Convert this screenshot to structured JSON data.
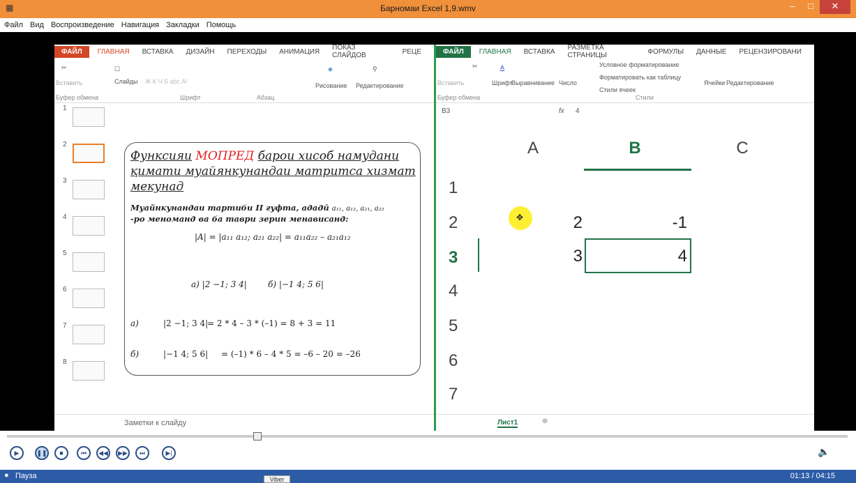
{
  "window": {
    "title": "Барномаи Excel 1,9.wmv"
  },
  "menu": [
    "Файл",
    "Вид",
    "Воспроизведение",
    "Навигация",
    "Закладки",
    "Помощь"
  ],
  "powerpoint": {
    "tabs": [
      "ФАЙЛ",
      "ГЛАВНАЯ",
      "ВСТАВКА",
      "ДИЗАЙН",
      "ПЕРЕХОДЫ",
      "АНИМАЦИЯ",
      "ПОКАЗ СЛАЙДОВ",
      "РЕЦЕ"
    ],
    "ribbon": {
      "paste": "Вставить",
      "slides": "Слайды",
      "drawing": "Рисование",
      "editing": "Редактирование"
    },
    "groups": {
      "clipboard": "Буфер обмена",
      "font": "Шрифт",
      "paragraph": "Абзац"
    },
    "slide_numbers": [
      "1",
      "2",
      "3",
      "4",
      "5",
      "6",
      "7",
      "8"
    ],
    "slide": {
      "title_1": "Функсияи",
      "title_red": "МОПРЕД",
      "title_2": "барои хисоб намудани қимати муайянкунандаи матритса хизмат мекунад",
      "subtitle_1": "Муайнкунандаи тартиби II гуфта, ададӣ",
      "subtitle_2": "-ро меноманд ва ба таври зерин менависанд:",
      "a_label": "а)",
      "b_label": "б)",
      "a_result": "= 2 * 4 – 3 * (–1) = 8 + 3 = 11",
      "b_result": "= (–1) * 6 – 4 * 5 = –6 – 20 = –26"
    },
    "notes": "Заметки к слайду"
  },
  "excel": {
    "tabs": [
      "ФАЙЛ",
      "ГЛАВНАЯ",
      "ВСТАВКА",
      "РАЗМЕТКА СТРАНИЦЫ",
      "ФОРМУЛЫ",
      "ДАННЫЕ",
      "РЕЦЕНЗИРОВАНИ"
    ],
    "ribbon": {
      "paste": "Вставить",
      "font": "Шрифт",
      "align": "Выравнивание",
      "number": "Число",
      "cond": "Условное форматирование",
      "table": "Форматировать как таблицу",
      "styles_cells": "Стили ячеек",
      "cells": "Ячейки",
      "editing": "Редактирование",
      "styles": "Стили",
      "clipboard": "Буфер обмена"
    },
    "namebox": "B3",
    "formula": "4",
    "columns": [
      "A",
      "B",
      "C"
    ],
    "rows": [
      "1",
      "2",
      "3",
      "4",
      "5",
      "6",
      "7"
    ],
    "cells": {
      "A2": "2",
      "B2": "-1",
      "A3": "3",
      "B3": "4"
    },
    "sheet_tab": "Лист1"
  },
  "player": {
    "status": "Пауза",
    "time": "01:13 / 04:15",
    "taskbar_item": "Viber"
  }
}
